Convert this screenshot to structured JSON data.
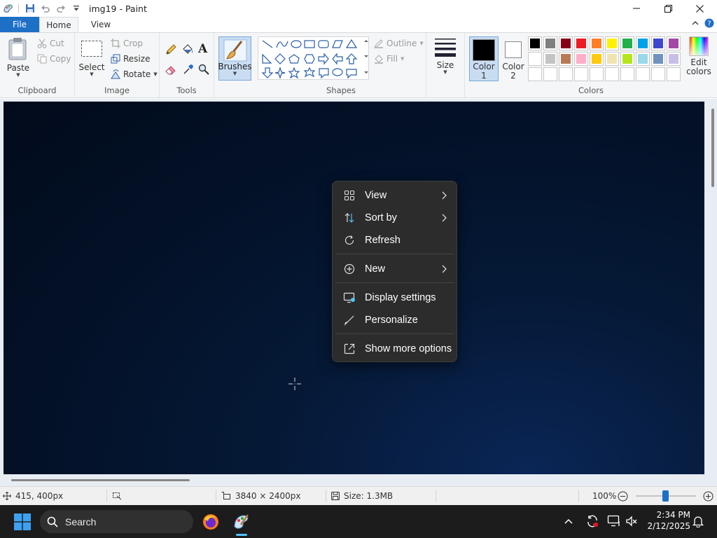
{
  "window": {
    "title": "img19 - Paint"
  },
  "tabs": {
    "file": "File",
    "home": "Home",
    "view": "View"
  },
  "ribbon": {
    "clipboard": {
      "paste": "Paste",
      "cut": "Cut",
      "copy": "Copy",
      "label": "Clipboard"
    },
    "image": {
      "select": "Select",
      "crop": "Crop",
      "resize": "Resize",
      "rotate": "Rotate",
      "label": "Image"
    },
    "tools": {
      "label": "Tools",
      "brushes": "Brushes"
    },
    "shapes": {
      "outline": "Outline",
      "fill": "Fill",
      "label": "Shapes",
      "size": "Size"
    },
    "colors": {
      "color1_line1": "Color",
      "color1_line2": "1",
      "color2_line1": "Color",
      "color2_line2": "2",
      "edit_line1": "Edit",
      "edit_line2": "colors",
      "label": "Colors",
      "color1_value": "#000000",
      "color2_value": "#ffffff",
      "palette_row1": [
        "#000000",
        "#7f7f7f",
        "#880015",
        "#ed1c24",
        "#ff7f27",
        "#fff200",
        "#22b14c",
        "#00a2e8",
        "#3f48cc",
        "#a349a4"
      ],
      "palette_row2": [
        "#ffffff",
        "#c3c3c3",
        "#b97a57",
        "#ffaec9",
        "#ffc90e",
        "#efe4b0",
        "#b5e61d",
        "#99d9ea",
        "#7092be",
        "#c8bfe7"
      ]
    }
  },
  "context_menu": {
    "items": [
      {
        "label": "View",
        "icon": "grid-icon",
        "submenu": true
      },
      {
        "label": "Sort by",
        "icon": "sort-icon",
        "submenu": true
      },
      {
        "label": "Refresh",
        "icon": "refresh-icon",
        "submenu": false
      },
      {
        "label": "New",
        "icon": "plus-circle-icon",
        "submenu": true
      },
      {
        "label": "Display settings",
        "icon": "display-icon",
        "submenu": false
      },
      {
        "label": "Personalize",
        "icon": "brush-icon",
        "submenu": false
      },
      {
        "label": "Show more options",
        "icon": "more-options-icon",
        "submenu": false
      }
    ]
  },
  "statusbar": {
    "cursor_pos": "415, 400px",
    "image_size": "3840 × 2400px",
    "file_size": "Size: 1.3MB",
    "zoom": "100%"
  },
  "taskbar": {
    "search_placeholder": "Search",
    "time": "2:34 PM",
    "date": "2/12/2025"
  }
}
